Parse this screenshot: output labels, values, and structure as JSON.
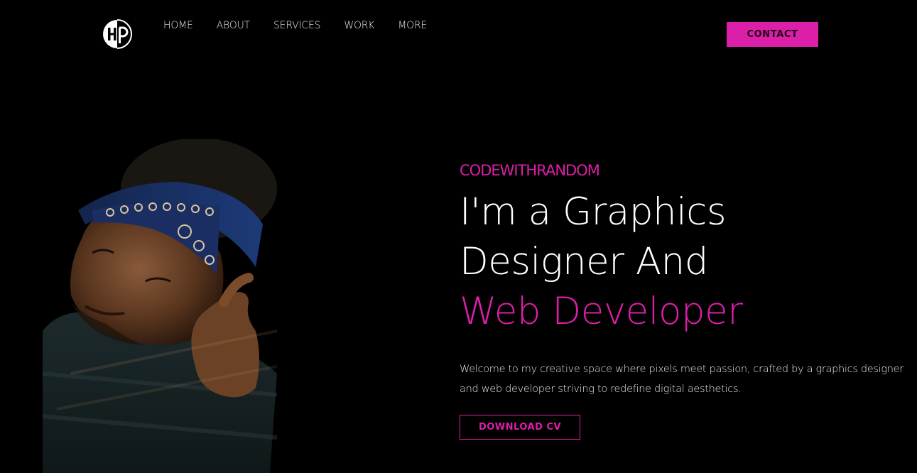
{
  "brand": {
    "logo_text": "HP",
    "accent_color": "#dc1fa8",
    "background_color": "#000000"
  },
  "nav": {
    "items": [
      {
        "label": "HOME"
      },
      {
        "label": "ABOUT"
      },
      {
        "label": "SERVICES"
      },
      {
        "label": "WORK"
      },
      {
        "label": "MORE"
      }
    ]
  },
  "header": {
    "contact_label": "CONTACT"
  },
  "hero": {
    "eyebrow": "CODEWITHRANDOM",
    "headline_line1": "I'm a Graphics",
    "headline_line2": "Designer And",
    "headline_line3": "Web Developer",
    "description": "Welcome to my creative space where pixels meet passion, crafted by a graphics designer and web developer striving to redefine digital aesthetics.",
    "cta_label": "DOWNLOAD CV"
  },
  "portrait": {
    "icon": "person-portrait-photo"
  }
}
